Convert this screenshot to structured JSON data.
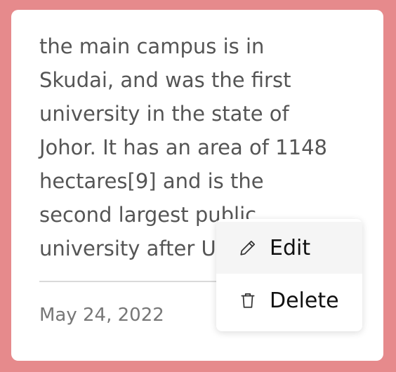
{
  "note": {
    "lines": [
      "the main campus is in",
      "Skudai, and was the first",
      "university in the state of",
      "Johor. It has an area of 1148",
      "hectares[9] and is the",
      "second largest public",
      "university after U"
    ],
    "date": "May 24, 2022"
  },
  "menu": {
    "items": [
      {
        "label": "Edit",
        "icon": "pencil-icon"
      },
      {
        "label": "Delete",
        "icon": "trash-icon"
      }
    ]
  },
  "colors": {
    "background": "#e68a8c",
    "card": "#ffffff",
    "text": "#555555",
    "menu_hover": "#f5f5f5"
  }
}
